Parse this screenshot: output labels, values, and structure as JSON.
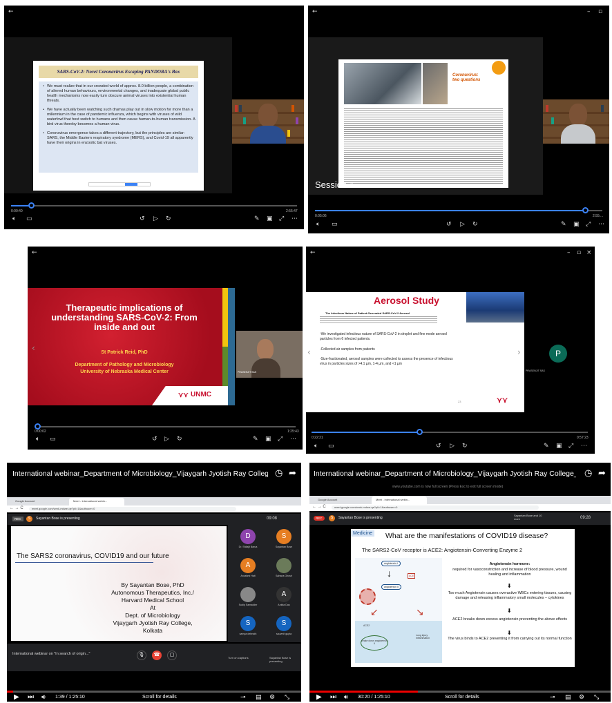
{
  "panel1": {
    "slide_title": "SARS-CoV-2: Novel Coronavirus Escaping PANDORA's Box",
    "bullets": [
      "We must realize that in our crowded world of approx. 8.0 billion people, a combination of altered human behaviours, environmental changes, and inadequate global public health mechanisms now easily turn obscure animal viruses into existential human threats.",
      "We have actually been watching such dramas play out in slow motion for more than a millennium in the case of pandemic influenza, which begins with viruses of wild waterfowl that host switch to humans and then cause human-to-human transmission. A bird virus thereby becomes a human-virus.",
      "Coronavirus emergence takes a different trajectory, but the principles are similar: SARS, the Middle Eastern respiratory syndrome (MERS), and Covid-19 all apparently have their origins in enzootic bat viruses."
    ],
    "time_left": "0:00:40",
    "time_right": "2:55:47",
    "progress": 0.07
  },
  "panel2": {
    "session_label": "Session 1",
    "article_heading": "Coronavirus: two questions",
    "time_left": "0:05:06",
    "time_right": "2:55:...",
    "progress": 0.94
  },
  "panel3": {
    "title": "Therapeutic implications of understanding SARS-CoV-2: From inside and out",
    "presenter": "St Patrick Reid, PhD",
    "dept": "Department of Pathology and Microbiology",
    "university": "University of Nebraska Medical Center",
    "logo": "UNMC",
    "cam_name": "PRASENJIT SAS",
    "time_left": "0:00:02",
    "time_right": "1:25:43",
    "progress": 0.01
  },
  "panel4": {
    "heading": "Aerosol Study",
    "paper_title": "The Infectious Nature of Patient-Generated SARS-CoV-2 Aerosol",
    "points": [
      "-We investigated infectious nature of SARS-CoV-2 in droplet and fine mode aerosol particles from 6 infected patients.",
      "-Collected air samples from patients",
      "-Size-fractionated, aerosol samples were collected to assess the presence of infectious virus in particles sizes of >4.1 µm, 1-4 µm, and <1 µm"
    ],
    "page_no": "23",
    "participant_initial": "P",
    "participant_name": "PRASENJIT SAS",
    "time_left": "0:22:21",
    "time_right": "0:57:23",
    "progress": 0.39
  },
  "panel5": {
    "video_title": "International webinar_Department of Microbiology_Vijaygarh Jyotish Ray College_Session:2",
    "tab1": "Google Account",
    "tab2": "Meet - International webin...",
    "url": "meet.google.com/wmk-mdwe-qe?pli=1&authuser=0",
    "rec": "REC",
    "presenting": "Sayantan Bose is presenting",
    "clock": "09:08",
    "slide_title": "The SARS2 coronavirus, COVID19 and our future",
    "byline": [
      "By Sayantan Bose, PhD",
      "Autonomous Therapeutics, Inc./",
      "Harvard Medical School",
      "At",
      "Dept. of Microbiology",
      "Vijaygarh Jyotish Ray College,",
      "Kolkata"
    ],
    "participants": [
      {
        "initial": "D",
        "name": "Dr. Shilajit Barua",
        "color": "#8e44ad"
      },
      {
        "initial": "S",
        "name": "Sayantan Bose",
        "color": "#e67e22"
      },
      {
        "initial": "A",
        "name": "Anushmi Hait",
        "color": "#e67e22"
      },
      {
        "initial": "",
        "name": "Sahana Ghosh",
        "color": "#6b7b5a"
      },
      {
        "initial": "",
        "name": "Sudip Samadder",
        "color": "#888"
      },
      {
        "initial": "A",
        "name": "Ankita Das",
        "color": "#333"
      },
      {
        "initial": "S",
        "name": "sampa debnath",
        "color": "#1565c0"
      },
      {
        "initial": "S",
        "name": "sauvmit gupta",
        "color": "#1565c0"
      }
    ],
    "meeting_name": "International webinar on \"In search of origin...\"",
    "captions_label": "Turn on captions",
    "presenting_short": "Sayantan Bose is presenting",
    "yt_time": "1:39 / 1:25:10",
    "scroll_label": "Scroll for details",
    "progress": 0.02
  },
  "panel6": {
    "video_title": "International webinar_Department of Microbiology_Vijaygarh Jyotish Ray College_Session:2",
    "fullscreen_note": "www.youtube.com is now full screen (Press Esc to exit full screen mode)",
    "tab1": "Google Account",
    "tab2": "Meet - International webin...",
    "url": "meet.google.com/wmk-mdwe-qe?pli=1&authuser=0",
    "rec": "REC",
    "presenting": "Sayantan Bose is presenting",
    "others": "Sayantan Bose and 10 more",
    "clock": "09:28",
    "medicine_tag": "Medicine",
    "question": "What are the manifestations of COVID19 disease?",
    "receptor": "The SARS2-CoV receptor is ACE2: Angiotensin-Converting Enzyme 2",
    "hormone_head": "Angiotensin hormone:",
    "hormone_body": "required for vasoconstriction and increase of blood pressure, wound healing and inflammation",
    "too_much": "Too much Angiotensin causes overactive WBCs entering tissues, causing damage and releasing inflammatory small molecules – cytokines",
    "ace2_breaks": "ACE2 breaks down excess angiotensin preventing the above effects",
    "virus_binds": "The virus binds to ACE2 preventing it from carrying out its normal function",
    "diagram_labels": [
      "angiotensin I",
      "ACE",
      "angiotensin II",
      "ACE2",
      "Lung injury Inflammation",
      "Brake down angiotensin II"
    ],
    "yt_time": "30:20 / 1:25:10",
    "scroll_label": "Scroll for details",
    "progress": 0.36
  },
  "colors": {
    "player_blue": "#3b82f6",
    "youtube_red": "#e00",
    "unmc_red": "#c8102e",
    "slide_blue": "#dde6f3"
  }
}
